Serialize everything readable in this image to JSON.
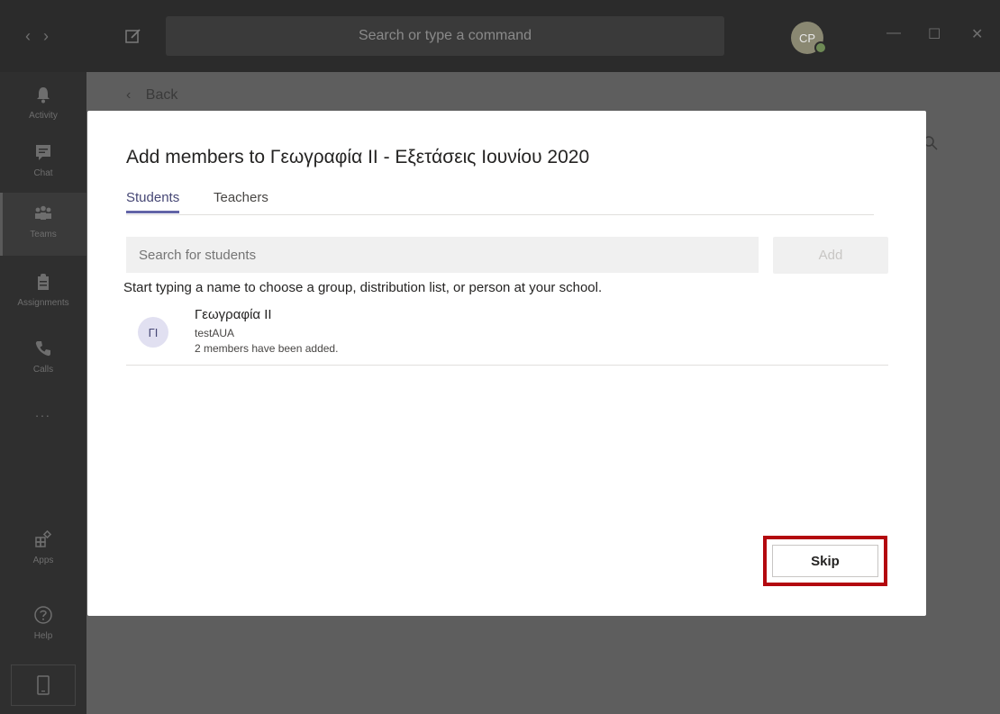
{
  "titlebar": {
    "search_placeholder": "Search or type a command",
    "avatar_initials": "CP",
    "back_arrow": "‹",
    "forward_arrow": "›",
    "minimize": "—",
    "maximize": "☐",
    "close": "✕"
  },
  "rail": {
    "items": [
      {
        "label": "Activity",
        "icon": "bell-icon"
      },
      {
        "label": "Chat",
        "icon": "chat-icon"
      },
      {
        "label": "Teams",
        "icon": "teams-icon"
      },
      {
        "label": "Assignments",
        "icon": "assignments-icon"
      },
      {
        "label": "Calls",
        "icon": "phone-icon"
      },
      {
        "label": "...",
        "icon": "more-icon"
      },
      {
        "label": "Apps",
        "icon": "apps-icon"
      },
      {
        "label": "Help",
        "icon": "help-icon"
      }
    ]
  },
  "background": {
    "back_label": "Back",
    "back_chevron": "‹"
  },
  "modal": {
    "title": "Add members to Γεωγραφία ΙΙ - Εξετάσεις Ιουνίου 2020",
    "tabs": [
      {
        "label": "Students",
        "active": true
      },
      {
        "label": "Teachers",
        "active": false
      }
    ],
    "search_placeholder": "Search for students",
    "add_label": "Add",
    "hint": "Start typing a name to choose a group, distribution list, or person at your school.",
    "result": {
      "initials": "ΓΙ",
      "name": "Γεωγραφία ΙΙ",
      "subtitle": "testAUA",
      "status": "2 members have been added."
    },
    "skip_label": "Skip"
  },
  "colors": {
    "accent": "#6264a7",
    "highlight": "#b3080f"
  }
}
